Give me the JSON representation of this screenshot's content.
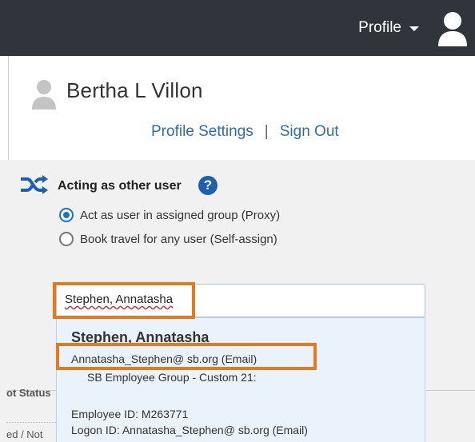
{
  "header": {
    "profile_label": "Profile",
    "icons": {
      "profile_caret": "chevron-down-icon",
      "avatar": "user-avatar-icon"
    }
  },
  "profile": {
    "user_name": "Bertha L Villon",
    "settings_link": "Profile Settings",
    "separator": "|",
    "sign_out_link": "Sign Out"
  },
  "acting": {
    "title": "Acting as other user",
    "help_glyph": "?",
    "options": [
      {
        "label": "Act as user in assigned group (Proxy)",
        "checked": true
      },
      {
        "label": "Book travel for any user (Self-assign)",
        "checked": false
      }
    ],
    "search_value": "Stephen, Annatasha"
  },
  "results": {
    "name": "Stephen, Annatasha",
    "email": "Annatasha_Stephen@ sb.org (Email)",
    "group": "SB Employee Group - Custom 21:",
    "employee_id": "Employee ID: M263771",
    "logon_id": "Logon ID: Annatasha_Stephen@ sb.org (Email)"
  },
  "background": {
    "partial_header": "ot Status",
    "partial_row": "ed / Not"
  },
  "colors": {
    "topbar": "#31353b",
    "link": "#2f6bb3",
    "accent": "#1a6fd8",
    "highlight": "#e47a20",
    "dropdown_bg": "#eaf3fb"
  }
}
